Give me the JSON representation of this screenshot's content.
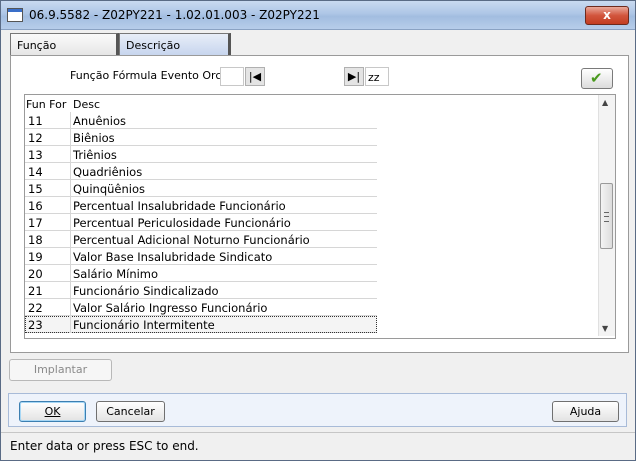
{
  "window": {
    "title": "06.9.5582 - Z02PY221 - 1.02.01.003 - Z02PY221",
    "close_label": "x"
  },
  "tabs": [
    {
      "label": "Função"
    },
    {
      "label": "Descrição"
    }
  ],
  "filter": {
    "label": "Função Fórmula Evento Orcto:",
    "from_value": "",
    "to_value": "zz"
  },
  "grid": {
    "columns": [
      "Fun For",
      "Desc"
    ],
    "rows": [
      {
        "code": "11",
        "desc": "Anuênios"
      },
      {
        "code": "12",
        "desc": "Biênios"
      },
      {
        "code": "13",
        "desc": "Triênios"
      },
      {
        "code": "14",
        "desc": "Quadriênios"
      },
      {
        "code": "15",
        "desc": "Quinqüênios"
      },
      {
        "code": "16",
        "desc": "Percentual Insalubridade Funcionário"
      },
      {
        "code": "17",
        "desc": "Percentual Periculosidade Funcionário"
      },
      {
        "code": "18",
        "desc": "Percentual Adicional Noturno Funcionário"
      },
      {
        "code": "19",
        "desc": "Valor Base Insalubridade Sindicato"
      },
      {
        "code": "20",
        "desc": "Salário Mínimo"
      },
      {
        "code": "21",
        "desc": "Funcionário Sindicalizado"
      },
      {
        "code": "22",
        "desc": "Valor Salário Ingresso Funcionário"
      },
      {
        "code": "23",
        "desc": "Funcionário Intermitente"
      }
    ],
    "selected_code": "23"
  },
  "buttons": {
    "implantar": "Implantar",
    "ok": "OK",
    "cancelar": "Cancelar",
    "ajuda": "Ajuda"
  },
  "status": {
    "text": "Enter data or press ESC to end."
  },
  "colors": {
    "confirm_check": "#4a9a1e",
    "close_button": "#c33d22"
  }
}
